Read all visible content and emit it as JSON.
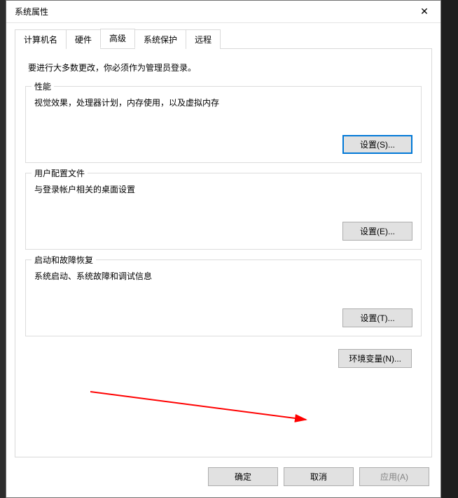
{
  "window": {
    "title": "系统属性"
  },
  "tabs": {
    "computer_name": "计算机名",
    "hardware": "硬件",
    "advanced": "高级",
    "system_protection": "系统保护",
    "remote": "远程"
  },
  "advanced_tab": {
    "admin_note": "要进行大多数更改，你必须作为管理员登录。",
    "performance": {
      "legend": "性能",
      "desc": "视觉效果，处理器计划，内存使用，以及虚拟内存",
      "button": "设置(S)..."
    },
    "user_profiles": {
      "legend": "用户配置文件",
      "desc": "与登录帐户相关的桌面设置",
      "button": "设置(E)..."
    },
    "startup_recovery": {
      "legend": "启动和故障恢复",
      "desc": "系统启动、系统故障和调试信息",
      "button": "设置(T)..."
    },
    "env_vars_button": "环境变量(N)..."
  },
  "buttons": {
    "ok": "确定",
    "cancel": "取消",
    "apply": "应用(A)"
  }
}
